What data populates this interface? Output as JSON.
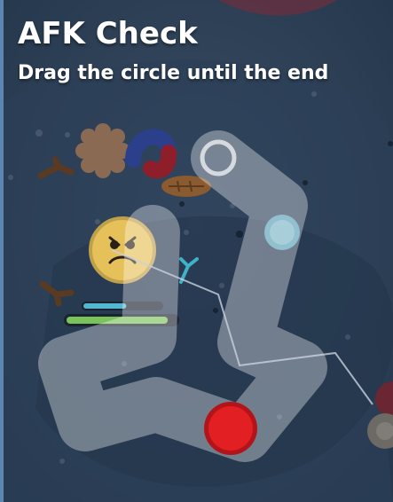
{
  "afk_check": {
    "title": "AFK Check",
    "instruction": "Drag the circle until the end"
  },
  "player": {
    "health_fraction": 0.92,
    "xp_fraction": 0.55
  },
  "colors": {
    "background": "#27394d",
    "path": "#ffffff",
    "drag_circle": "#e21f22",
    "drag_circle_border": "#b3141a",
    "health_bar": "#7ac35a",
    "xp_bar": "#53b7d2",
    "player_body": "#e6c15a"
  },
  "icons": {
    "start": "circle-outline-icon",
    "handle": "drag-circle-icon"
  }
}
